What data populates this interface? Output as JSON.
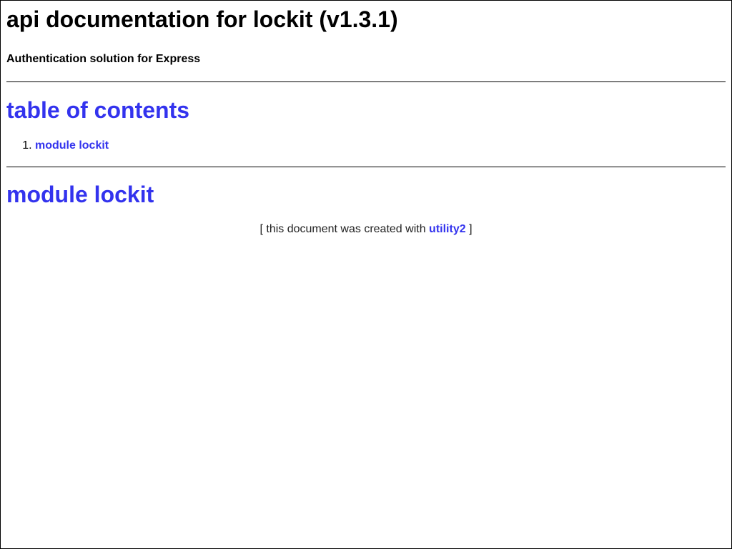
{
  "header": {
    "title": "api documentation for lockit (v1.3.1)",
    "subtitle": "Authentication solution for Express"
  },
  "toc": {
    "heading": "table of contents",
    "items": [
      {
        "number": "1.",
        "label": "module lockit"
      }
    ]
  },
  "module": {
    "heading": "module lockit"
  },
  "footer": {
    "prefix": "[ this document was created with",
    "link_label": "utility2",
    "suffix": "]"
  },
  "colors": {
    "link": "#3333ee",
    "text": "#000000"
  }
}
